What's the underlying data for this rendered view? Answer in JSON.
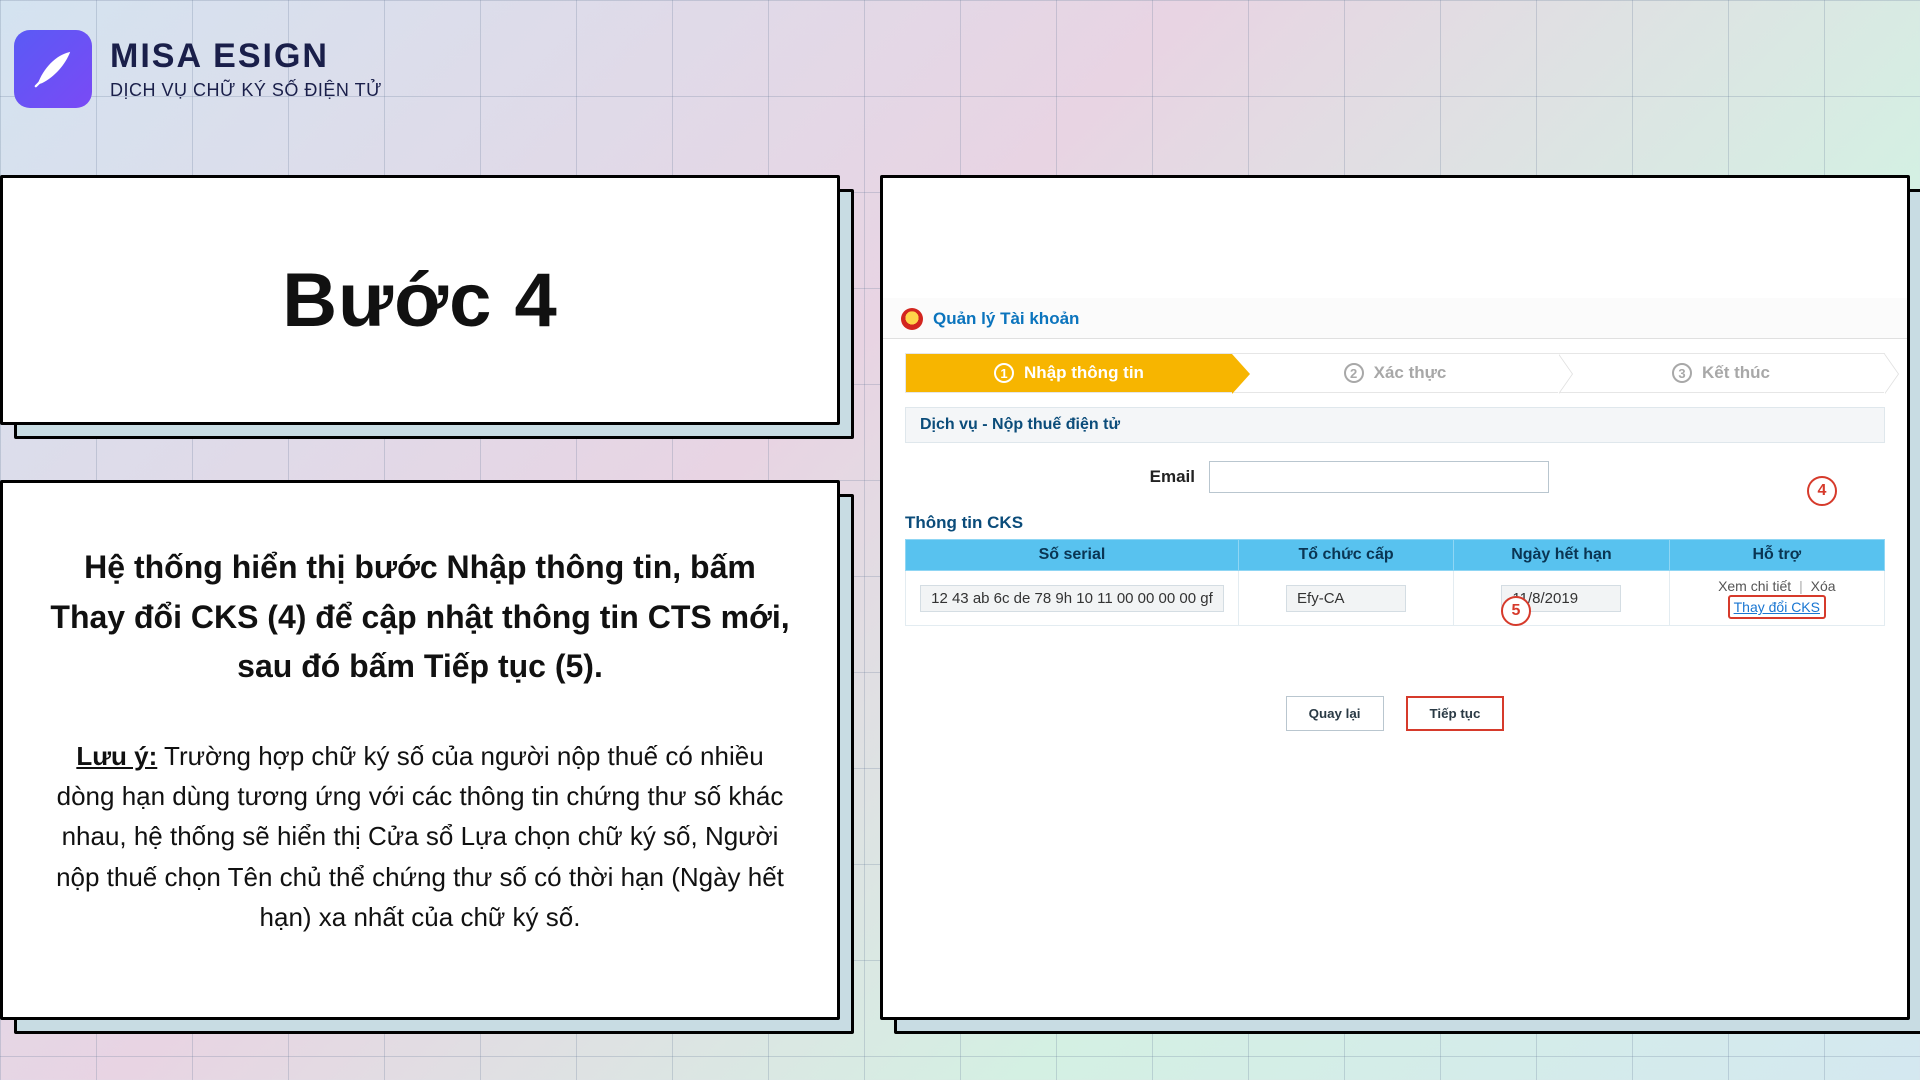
{
  "brand": {
    "name": "MISA ESIGN",
    "tagline": "DỊCH VỤ CHỮ KÝ SỐ ĐIỆN TỬ"
  },
  "step": {
    "title": "Bước 4",
    "instruction": "Hệ thống hiển thị bước Nhập thông tin, bấm Thay đổi CKS (4) để cập nhật thông tin CTS mới, sau đó bấm Tiếp tục (5).",
    "note_label": "Lưu ý:",
    "note_body": " Trường hợp chữ ký số của người nộp thuế có nhiều dòng hạn dùng tương ứng với các thông tin chứng thư số khác nhau, hệ thống sẽ hiển thị Cửa sổ Lựa chọn chữ ký số, Người nộp thuế chọn Tên chủ thể chứng thư số có thời hạn (Ngày hết hạn) xa nhất của chữ ký số."
  },
  "tax_ui": {
    "panel_title": "Quản lý Tài khoản",
    "steps": {
      "s1": "Nhập thông tin",
      "s2": "Xác thực",
      "s3": "Kết thúc",
      "n1": "1",
      "n2": "2",
      "n3": "3"
    },
    "service_header": "Dịch vụ - Nộp thuế điện tử",
    "email_label": "Email",
    "cks_heading": "Thông tin CKS",
    "cols": {
      "serial": "Số serial",
      "issuer": "Tổ chức cấp",
      "expiry": "Ngày hết hạn",
      "support": "Hỗ trợ"
    },
    "row": {
      "serial": "12 43 ab 6c de 78 9h 10 11 00 00 00 00 gf",
      "issuer": "Efy-CA",
      "expiry": "11/8/2019",
      "view": "Xem chi tiết",
      "delete": "Xóa",
      "change": "Thay đổi CKS"
    },
    "buttons": {
      "back": "Quay lại",
      "next": "Tiếp tục"
    },
    "callouts": {
      "c4": "4",
      "c5": "5"
    }
  }
}
